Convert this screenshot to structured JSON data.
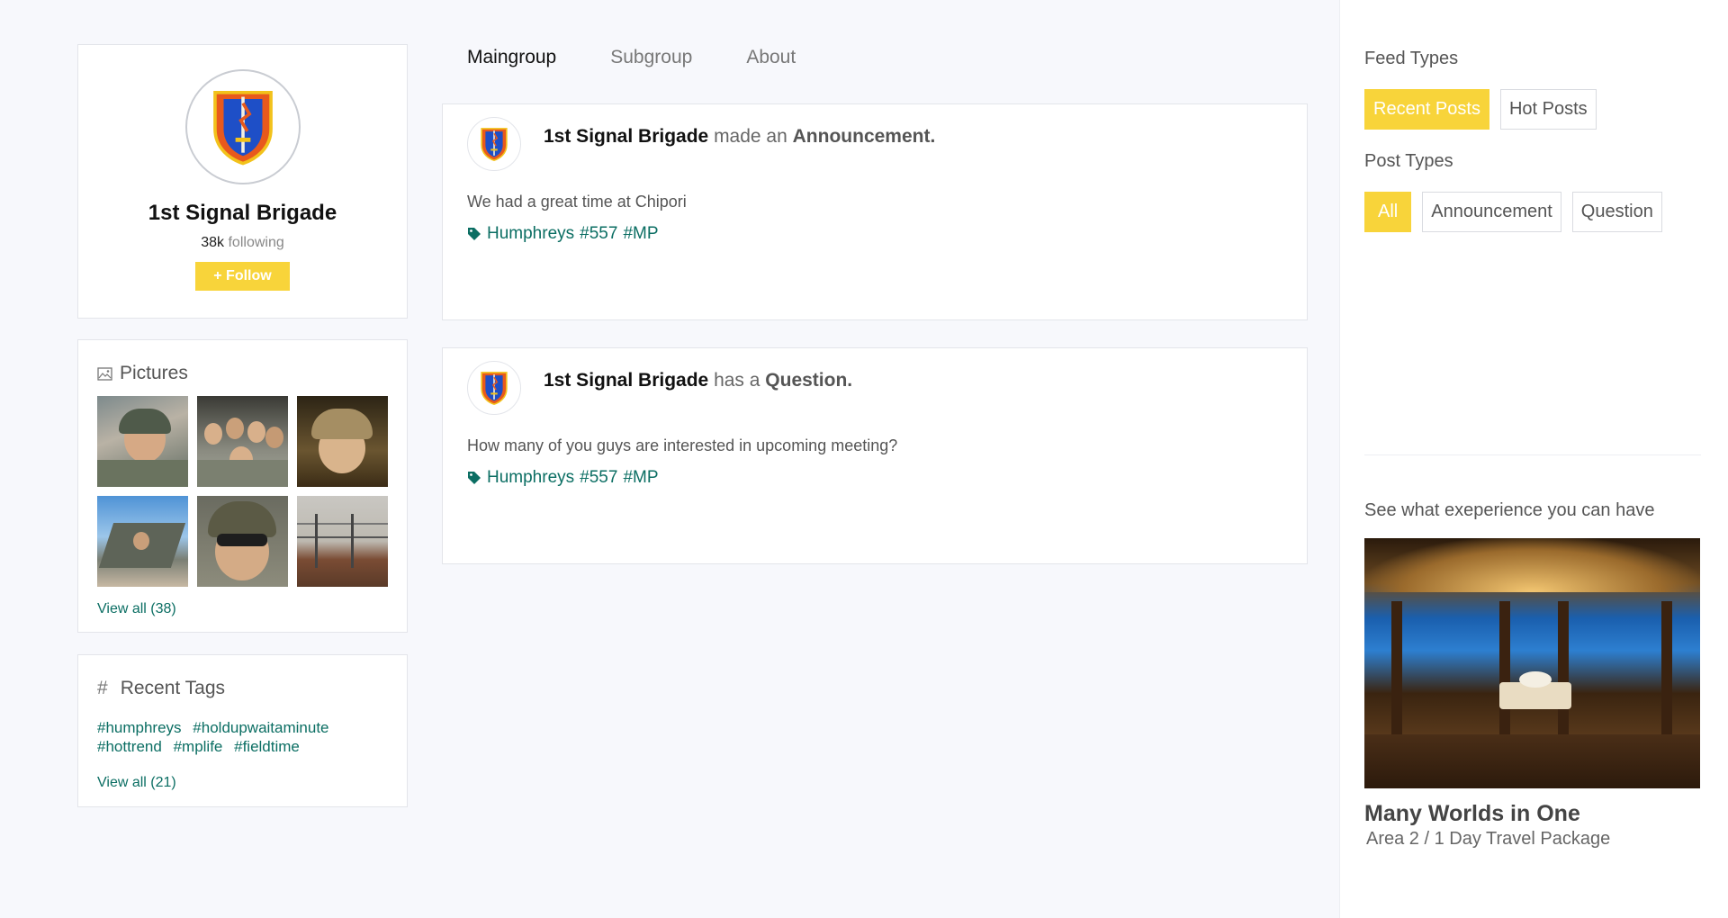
{
  "profile": {
    "name": "1st Signal Brigade",
    "following_count": "38k",
    "following_label": "following",
    "follow_label": "+ Follow"
  },
  "pictures": {
    "title": "Pictures",
    "view_all": "View all (38)",
    "items": [
      "soldier-selfie",
      "group-photo",
      "soldier-portrait",
      "aircraft-crew",
      "soldier-helmet",
      "border-fence"
    ]
  },
  "recent_tags": {
    "title": "Recent Tags",
    "hash": "#",
    "tags": [
      "#humphreys",
      "#holdupwaitaminute",
      "#hottrend",
      "#mplife",
      "#fieldtime"
    ],
    "view_all": "View all (21)"
  },
  "tabs": [
    {
      "label": "Maingroup",
      "active": true
    },
    {
      "label": "Subgroup",
      "active": false
    },
    {
      "label": "About",
      "active": false
    }
  ],
  "posts": [
    {
      "author": "1st Signal Brigade",
      "verb": "made an",
      "type": "Announcement.",
      "body": "We had a great time at Chipori",
      "tags": [
        "Humphreys",
        "#557",
        "#MP"
      ]
    },
    {
      "author": "1st Signal Brigade",
      "verb": "has a",
      "type": "Question.",
      "body": "How many of you guys are interested in upcoming meeting?",
      "tags": [
        "Humphreys",
        "#557",
        "#MP"
      ]
    }
  ],
  "right_panel": {
    "feed_types_title": "Feed Types",
    "feed_types": [
      {
        "label": "Recent Posts",
        "selected": true
      },
      {
        "label": "Hot Posts",
        "selected": false
      }
    ],
    "post_types_title": "Post Types",
    "post_types": [
      {
        "label": "All",
        "selected": true
      },
      {
        "label": "Announcement",
        "selected": false
      },
      {
        "label": "Question",
        "selected": false
      }
    ],
    "promo_heading": "See what exeperience you can have",
    "promo_title": "Many Worlds in One",
    "promo_subtitle": "Area 2 / 1 Day Travel Package"
  },
  "colors": {
    "accent": "#f8d43a",
    "link": "#0b6e63",
    "background": "#f7f8fc"
  }
}
